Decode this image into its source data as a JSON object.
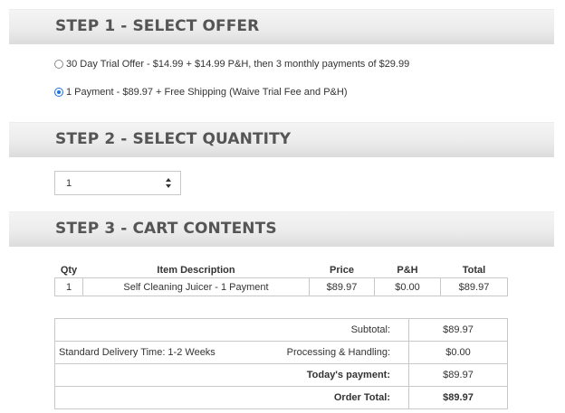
{
  "steps": {
    "step1": "STEP 1 - SELECT OFFER",
    "step2": "STEP 2 - SELECT QUANTITY",
    "step3": "STEP 3 - CART CONTENTS"
  },
  "offers": [
    {
      "label": "30 Day Trial Offer - $14.99 + $14.99 P&H, then 3 monthly payments of $29.99",
      "selected": false
    },
    {
      "label": "1 Payment - $89.97 + Free Shipping (Waive Trial Fee and P&H)",
      "selected": true
    }
  ],
  "quantity": {
    "selected": "1"
  },
  "cart": {
    "headers": [
      "Qty",
      "Item Description",
      "Price",
      "P&H",
      "Total"
    ],
    "rows": [
      [
        "1",
        "Self Cleaning Juicer - 1 Payment",
        "$89.97",
        "$0.00",
        "$89.97"
      ]
    ]
  },
  "totals": {
    "subtotal_label": "Subtotal:",
    "subtotal_value": "$89.97",
    "delivery_text": "Standard Delivery Time: 1-2 Weeks",
    "processing_label": "Processing & Handling:",
    "processing_value": "$0.00",
    "today_label": "Today's payment:",
    "today_value": "$89.97",
    "order_label": "Order Total:",
    "order_value": "$89.97"
  },
  "colors": {
    "accent": "#1a73e8",
    "header_text": "#555555"
  }
}
